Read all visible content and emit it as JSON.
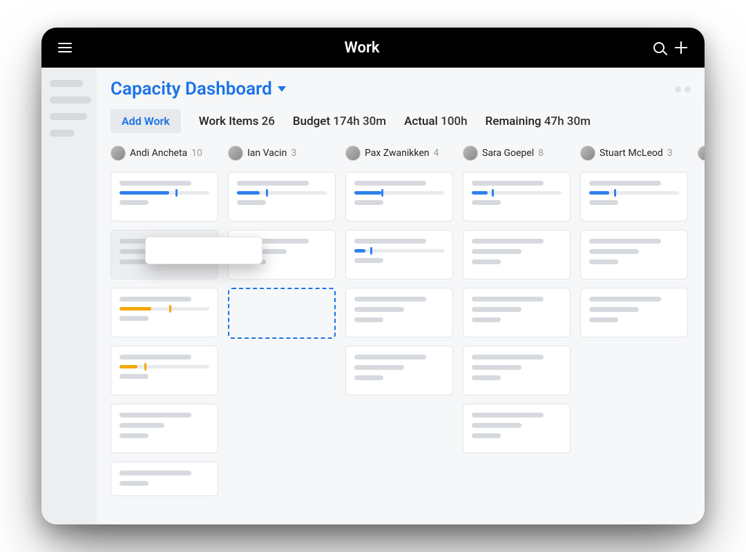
{
  "topbar": {
    "title": "Work"
  },
  "header": {
    "title": "Capacity Dashboard"
  },
  "toolbar": {
    "add_work_label": "Add Work",
    "work_items_label": "Work Items",
    "work_items_value": "26",
    "budget_label": "Budget",
    "budget_value": "174h 30m",
    "actual_label": "Actual",
    "actual_value": "100h",
    "remaining_label": "Remaining",
    "remaining_value": "47h 30m"
  },
  "columns": [
    {
      "name": "Andi Ancheta",
      "count": "10"
    },
    {
      "name": "Ian Vacin",
      "count": "3"
    },
    {
      "name": "Pax Zwanikken",
      "count": "4"
    },
    {
      "name": "Sara Goepel",
      "count": "8"
    },
    {
      "name": "Stuart McLeod",
      "count": "3"
    }
  ]
}
